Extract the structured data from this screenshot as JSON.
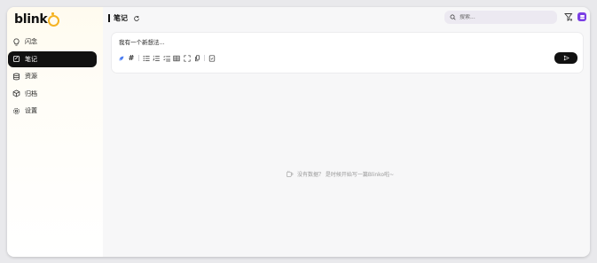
{
  "app": {
    "logo_text": "blink",
    "brand_color": "#f5b323",
    "accent_color": "#7b3fe4"
  },
  "sidebar": {
    "items": [
      {
        "label": "闪念",
        "icon": "lightbulb-icon",
        "active": false
      },
      {
        "label": "笔记",
        "icon": "note-icon",
        "active": true
      },
      {
        "label": "资源",
        "icon": "database-icon",
        "active": false
      },
      {
        "label": "归档",
        "icon": "box-icon",
        "active": false
      },
      {
        "label": "设置",
        "icon": "gear-icon",
        "active": false
      }
    ]
  },
  "header": {
    "title": "笔记",
    "search_placeholder": "搜索..."
  },
  "editor": {
    "placeholder": "我有一个新想法...",
    "toolbar": [
      "blinko-icon",
      "hashtag-icon",
      "bullet-list-icon",
      "ordered-list-icon",
      "checklist-icon",
      "table-icon",
      "fullscreen-icon",
      "upload-icon",
      "file-icon"
    ],
    "hashtag_glyph": "#"
  },
  "main": {
    "empty_text": "没有数据？ 是时候开始写一篇Blinko啦~"
  }
}
